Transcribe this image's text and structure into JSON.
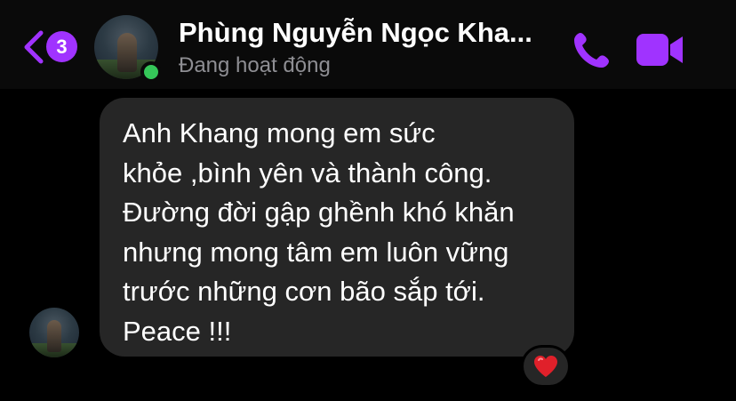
{
  "header": {
    "back_badge_count": "3",
    "contact_name": "Phùng Nguyễn Ngọc Kha...",
    "status": "Đang hoạt động"
  },
  "icons": {
    "back": "chevron-left-icon",
    "call": "phone-icon",
    "video": "video-camera-icon",
    "reaction": "heart-icon"
  },
  "colors": {
    "accent": "#a033ff",
    "online": "#35c759",
    "bubble": "#262626",
    "reaction": "#e0202a"
  },
  "message": {
    "text": "Anh Khang mong em sức\nkhỏe ,bình yên và thành công.\nĐường đời gập ghềnh khó khăn\nnhưng mong tâm em luôn vững\ntrước những cơn bão sắp tới.\nPeace !!!"
  }
}
